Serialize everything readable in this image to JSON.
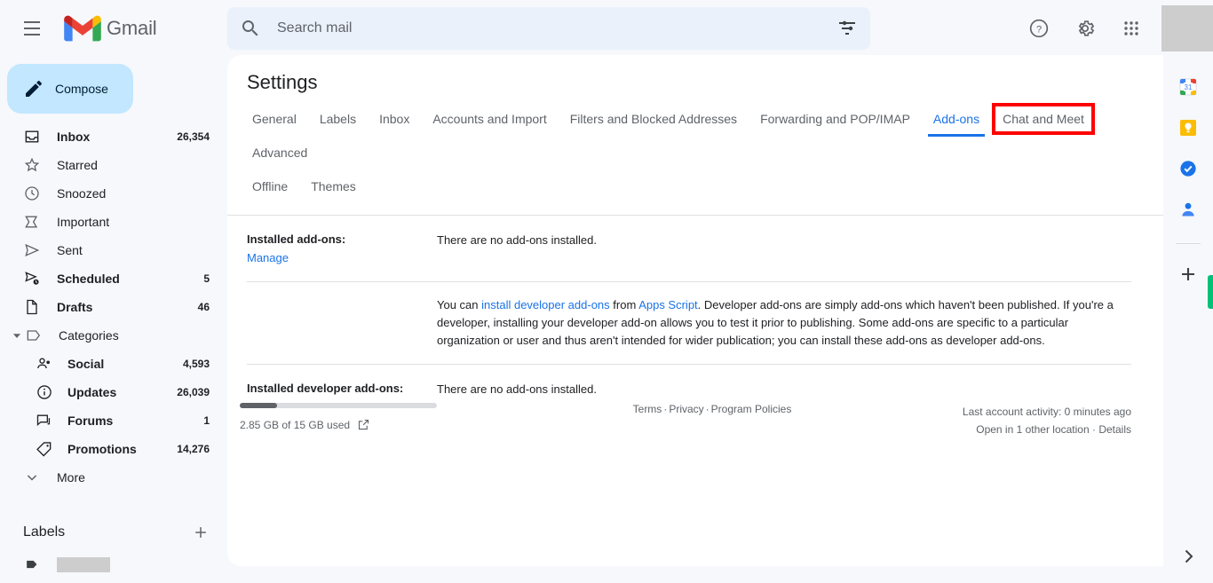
{
  "header": {
    "menu_icon": "hamburger-menu-icon",
    "logo_text": "Gmail",
    "search_placeholder": "Search mail",
    "search_value": "",
    "search_icon": "search-icon",
    "filter_icon": "tune-filter-icon",
    "help_icon": "help-circle-icon",
    "settings_icon": "gear-icon",
    "apps_icon": "apps-grid-icon"
  },
  "sidebar": {
    "compose_label": "Compose",
    "compose_icon": "pencil-icon",
    "items": [
      {
        "label": "Inbox",
        "count": "26,354",
        "icon": "inbox-icon",
        "bold": true
      },
      {
        "label": "Starred",
        "count": "",
        "icon": "star-icon",
        "bold": false
      },
      {
        "label": "Snoozed",
        "count": "",
        "icon": "clock-icon",
        "bold": false
      },
      {
        "label": "Important",
        "count": "",
        "icon": "important-icon",
        "bold": false
      },
      {
        "label": "Sent",
        "count": "",
        "icon": "send-icon",
        "bold": false
      },
      {
        "label": "Scheduled",
        "count": "5",
        "icon": "scheduled-icon",
        "bold": true
      },
      {
        "label": "Drafts",
        "count": "46",
        "icon": "draft-icon",
        "bold": true
      }
    ],
    "categories_label": "Categories",
    "categories_icon": "label-outline-icon",
    "categories": [
      {
        "label": "Social",
        "count": "4,593",
        "icon": "people-icon"
      },
      {
        "label": "Updates",
        "count": "26,039",
        "icon": "info-icon"
      },
      {
        "label": "Forums",
        "count": "1",
        "icon": "forum-icon"
      },
      {
        "label": "Promotions",
        "count": "14,276",
        "icon": "tag-icon"
      }
    ],
    "more_label": "More",
    "more_icon": "chevron-down-icon",
    "labels_title": "Labels",
    "labels_add_icon": "plus-icon",
    "label_item_icon": "label-filled-icon"
  },
  "settings": {
    "title": "Settings",
    "tabs_row1": [
      {
        "label": "General",
        "active": false,
        "boxed": false
      },
      {
        "label": "Labels",
        "active": false,
        "boxed": false
      },
      {
        "label": "Inbox",
        "active": false,
        "boxed": false
      },
      {
        "label": "Accounts and Import",
        "active": false,
        "boxed": false
      },
      {
        "label": "Filters and Blocked Addresses",
        "active": false,
        "boxed": false
      },
      {
        "label": "Forwarding and POP/IMAP",
        "active": false,
        "boxed": false
      },
      {
        "label": "Add-ons",
        "active": true,
        "boxed": false
      },
      {
        "label": "Chat and Meet",
        "active": false,
        "boxed": true
      },
      {
        "label": "Advanced",
        "active": false,
        "boxed": false
      }
    ],
    "tabs_row2": [
      {
        "label": "Offline",
        "active": false,
        "boxed": false
      },
      {
        "label": "Themes",
        "active": false,
        "boxed": false
      }
    ],
    "highlight_color": "#ff0000",
    "accent_color": "#1a73e8",
    "sections": {
      "installed_label": "Installed add-ons:",
      "installed_manage": "Manage",
      "installed_body": "There are no add-ons installed.",
      "dev_info_prefix": "You can ",
      "dev_info_link1": "install developer add-ons",
      "dev_info_mid": " from ",
      "dev_info_link2": "Apps Script",
      "dev_info_suffix": ". Developer add-ons are simply add-ons which haven't been published. If you're a developer, installing your developer add-on allows you to test it prior to publishing. Some add-ons are specific to a particular organization or user and thus aren't intended for wider publication; you can install these add-ons as developer add-ons.",
      "dev_installed_label": "Installed developer add-ons:",
      "dev_installed_body": "There are no add-ons installed."
    }
  },
  "footer": {
    "storage_text": "2.85 GB of 15 GB used",
    "storage_icon": "open-in-new-icon",
    "storage_percent": 19,
    "links": [
      "Terms",
      "Privacy",
      "Program Policies"
    ],
    "activity_line1": "Last account activity: 0 minutes ago",
    "activity_line2": "Open in 1 other location · Details"
  },
  "right_panel": {
    "icons": [
      {
        "name": "google-calendar-icon"
      },
      {
        "name": "google-keep-icon"
      },
      {
        "name": "google-tasks-icon"
      },
      {
        "name": "google-contacts-icon"
      }
    ],
    "add_icon": "plus-icon",
    "expand_icon": "chevron-right-icon",
    "indicator_color": "#00c278"
  }
}
